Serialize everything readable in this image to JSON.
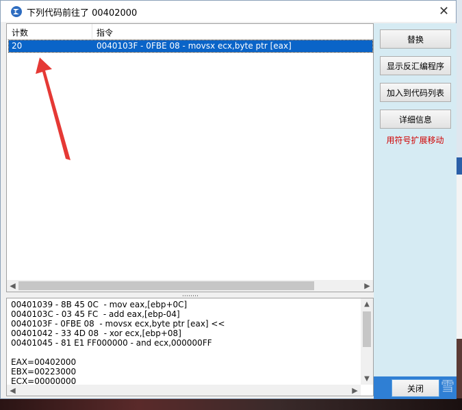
{
  "window": {
    "title": "下列代码前往了 00402000",
    "close_glyph": "✕"
  },
  "list": {
    "columns": [
      "计数",
      "指令"
    ],
    "rows": [
      {
        "count": "20",
        "instruction": "0040103F - 0FBE 08  - movsx ecx,byte ptr [eax]"
      }
    ]
  },
  "disasm": {
    "lines": [
      "00401039 - 8B 45 0C  - mov eax,[ebp+0C]",
      "0040103C - 03 45 FC  - add eax,[ebp-04]",
      "0040103F - 0FBE 08  - movsx ecx,byte ptr [eax] <<",
      "00401042 - 33 4D 08  - xor ecx,[ebp+08]",
      "00401045 - 81 E1 FF000000 - and ecx,000000FF",
      "",
      "EAX=00402000",
      "EBX=00223000",
      "ECX=00000000"
    ]
  },
  "side": {
    "buttons": [
      "替换",
      "显示反汇编程序",
      "加入到代码列表",
      "详细信息"
    ],
    "note": "用符号扩展移动",
    "close_label": "关闭",
    "watermark": "雪"
  },
  "colors": {
    "selection": "#0a64c8",
    "side_panel": "#d6ebf3",
    "note_red": "#d00000",
    "arrow_red": "#e53935"
  }
}
